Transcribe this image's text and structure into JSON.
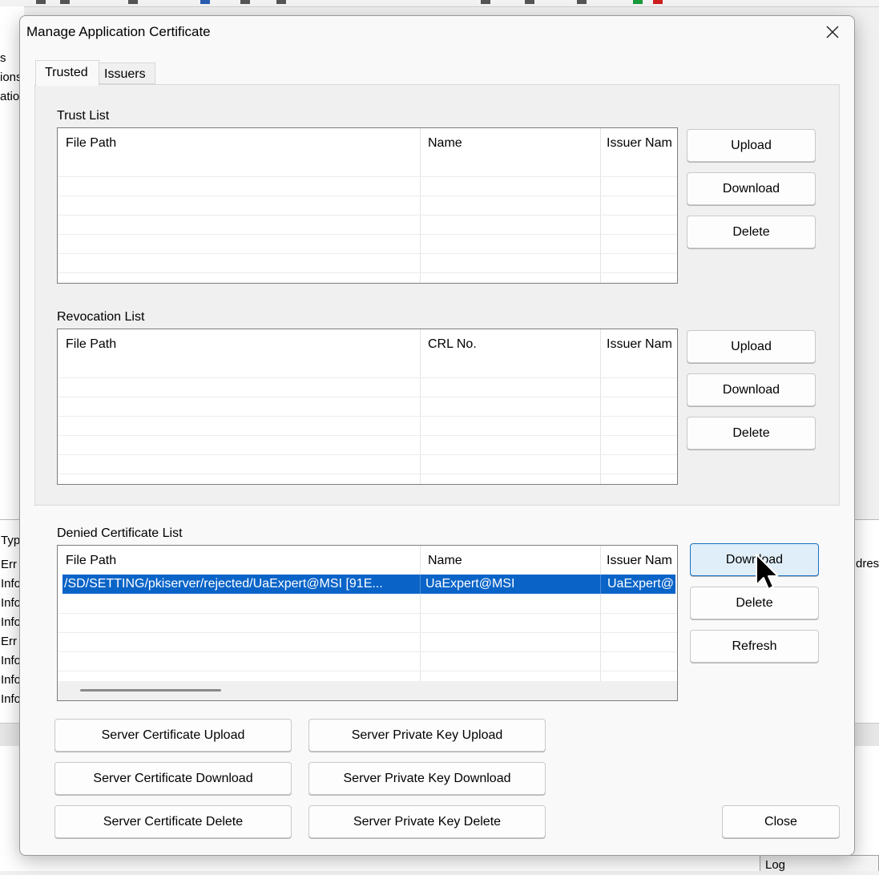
{
  "background": {
    "left_items": [
      "s",
      "ions",
      "atio"
    ],
    "log_rows": [
      "Typ",
      "Err",
      "Info",
      "Info",
      "Info",
      "Err",
      "Info",
      "Info",
      "Info"
    ],
    "log_right_fragment": "dres",
    "log_tab": "Log"
  },
  "dialog": {
    "title": "Manage Application Certificate",
    "tabs": [
      {
        "label": "Trusted",
        "selected": true
      },
      {
        "label": "Issuers",
        "selected": false
      }
    ]
  },
  "trust_list": {
    "label": "Trust List",
    "columns": [
      "File Path",
      "Name",
      "Issuer Nam"
    ],
    "buttons": [
      "Upload",
      "Download",
      "Delete"
    ]
  },
  "revocation_list": {
    "label": "Revocation List",
    "columns": [
      "File Path",
      "CRL No.",
      "Issuer Nam"
    ],
    "buttons": [
      "Upload",
      "Download",
      "Delete"
    ]
  },
  "denied_list": {
    "label": "Denied Certificate List",
    "columns": [
      "File Path",
      "Name",
      "Issuer Nam"
    ],
    "rows": [
      {
        "file_path": "/SD/SETTING/pkiserver/rejected/UaExpert@MSI [91E...",
        "name": "UaExpert@MSI",
        "issuer": "UaExpert@",
        "selected": true
      }
    ],
    "buttons": [
      "Download",
      "Delete",
      "Refresh"
    ],
    "hovered_button": "Download"
  },
  "server_buttons": {
    "cert_upload": "Server Certificate Upload",
    "key_upload": "Server Private Key Upload",
    "cert_download": "Server Certificate Download",
    "key_download": "Server Private Key Download",
    "cert_delete": "Server Certificate Delete",
    "key_delete": "Server Private Key Delete"
  },
  "close_button": "Close",
  "icons": {
    "close": "close-icon",
    "cursor": "mouse-pointer-icon"
  }
}
